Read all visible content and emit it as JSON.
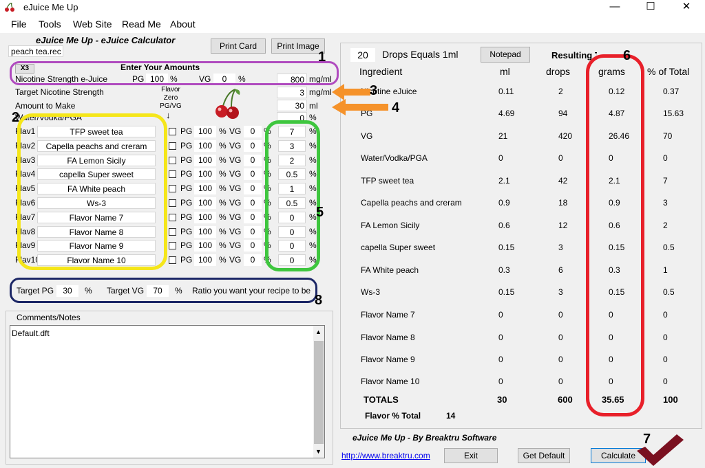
{
  "window": {
    "title": "eJuice Me Up"
  },
  "menu": [
    "File",
    "Tools",
    "Web Site",
    "Read Me",
    "About"
  ],
  "left": {
    "app_header": "eJuice Me Up - eJuice Calculator",
    "recipe_file": "peach tea.rec",
    "print_card": "Print Card",
    "print_image": "Print Image",
    "x3": "X3",
    "enter_amounts": "Enter Your Amounts",
    "nic_label": "Nicotine Strength e-Juice",
    "pg_label": "PG",
    "vg_label": "VG",
    "pct": "%",
    "nic_pg": "100",
    "nic_vg": "0",
    "nic_strength": "800",
    "mgml": "mg/ml",
    "target_nic_label": "Target Nicotine Strength",
    "target_nic": "3",
    "amount_label": "Amount to Make",
    "amount": "30",
    "ml": "ml",
    "water_label": "Water/Vodka/PGA",
    "water_value": "0",
    "flavor_zero_label": "Flavor Zero PG/VG",
    "down_arrow": "↓",
    "flavors": [
      {
        "label": "Flav1",
        "name": "TFP sweet tea",
        "pg": "100",
        "vg": "0",
        "pct": "7"
      },
      {
        "label": "Flav2",
        "name": "Capella peachs and creram",
        "pg": "100",
        "vg": "0",
        "pct": "3"
      },
      {
        "label": "Flav3",
        "name": "FA Lemon Sicily",
        "pg": "100",
        "vg": "0",
        "pct": "2"
      },
      {
        "label": "Flav4",
        "name": "capella Super sweet",
        "pg": "100",
        "vg": "0",
        "pct": "0.5"
      },
      {
        "label": "Flav5",
        "name": "FA White peach",
        "pg": "100",
        "vg": "0",
        "pct": "1"
      },
      {
        "label": "Flav6",
        "name": "Ws-3",
        "pg": "100",
        "vg": "0",
        "pct": "0.5"
      },
      {
        "label": "Flav7",
        "name": "Flavor Name 7",
        "pg": "100",
        "vg": "0",
        "pct": "0"
      },
      {
        "label": "Flav8",
        "name": "Flavor Name 8",
        "pg": "100",
        "vg": "0",
        "pct": "0"
      },
      {
        "label": "Flav9",
        "name": "Flavor Name 9",
        "pg": "100",
        "vg": "0",
        "pct": "0"
      },
      {
        "label": "Flav10",
        "name": "Flavor Name 10",
        "pg": "100",
        "vg": "0",
        "pct": "0"
      }
    ],
    "target_pg_label": "Target PG",
    "target_pg": "30",
    "target_vg_label": "Target VG",
    "target_vg": "70",
    "ratio_text": "Ratio you want your recipe to be",
    "comments_label": "Comments/Notes",
    "comments_value": "Default.dft"
  },
  "right": {
    "drops": "20",
    "drops_label": "Drops Equals 1ml",
    "notepad": "Notepad",
    "resulting_label": "Resulting Totals",
    "headers": [
      "Ingredient",
      "ml",
      "drops",
      "grams",
      "% of Total"
    ],
    "rows": [
      {
        "name": "Nicotine eJuice",
        "ml": "0.11",
        "drops": "2",
        "grams": "0.12",
        "pct": "0.37"
      },
      {
        "name": "PG",
        "ml": "4.69",
        "drops": "94",
        "grams": "4.87",
        "pct": "15.63"
      },
      {
        "name": "VG",
        "ml": "21",
        "drops": "420",
        "grams": "26.46",
        "pct": "70"
      },
      {
        "name": "Water/Vodka/PGA",
        "ml": "0",
        "drops": "0",
        "grams": "0",
        "pct": "0"
      },
      {
        "name": "TFP sweet tea",
        "ml": "2.1",
        "drops": "42",
        "grams": "2.1",
        "pct": "7"
      },
      {
        "name": "Capella peachs and creram",
        "ml": "0.9",
        "drops": "18",
        "grams": "0.9",
        "pct": "3"
      },
      {
        "name": "FA Lemon Sicily",
        "ml": "0.6",
        "drops": "12",
        "grams": "0.6",
        "pct": "2"
      },
      {
        "name": "capella Super sweet",
        "ml": "0.15",
        "drops": "3",
        "grams": "0.15",
        "pct": "0.5"
      },
      {
        "name": "FA White peach",
        "ml": "0.3",
        "drops": "6",
        "grams": "0.3",
        "pct": "1"
      },
      {
        "name": "Ws-3",
        "ml": "0.15",
        "drops": "3",
        "grams": "0.15",
        "pct": "0.5"
      },
      {
        "name": "Flavor Name 7",
        "ml": "0",
        "drops": "0",
        "grams": "0",
        "pct": "0"
      },
      {
        "name": "Flavor Name 8",
        "ml": "0",
        "drops": "0",
        "grams": "0",
        "pct": "0"
      },
      {
        "name": "Flavor Name 9",
        "ml": "0",
        "drops": "0",
        "grams": "0",
        "pct": "0"
      },
      {
        "name": "Flavor Name 10",
        "ml": "0",
        "drops": "0",
        "grams": "0",
        "pct": "0"
      }
    ],
    "totals": {
      "label": "TOTALS",
      "ml": "30",
      "drops": "600",
      "grams": "35.65",
      "pct": "100"
    },
    "flavor_total_label": "Flavor % Total",
    "flavor_total": "14"
  },
  "footer": {
    "brand": "eJuice Me Up  -  By Breaktru Software",
    "link": "http://www.breaktru.com",
    "exit": "Exit",
    "get_default": "Get Default",
    "calculate": "Calculate"
  },
  "annotations": [
    "1",
    "2",
    "3",
    "4",
    "5",
    "6",
    "7",
    "8"
  ],
  "colors": {
    "purple": "#b04bbf",
    "yellow": "#f5e61a",
    "green": "#3ec63e",
    "navy": "#1c2766",
    "red": "#e8202a",
    "orange": "#f5922a",
    "checkmark": "#7a1020"
  }
}
